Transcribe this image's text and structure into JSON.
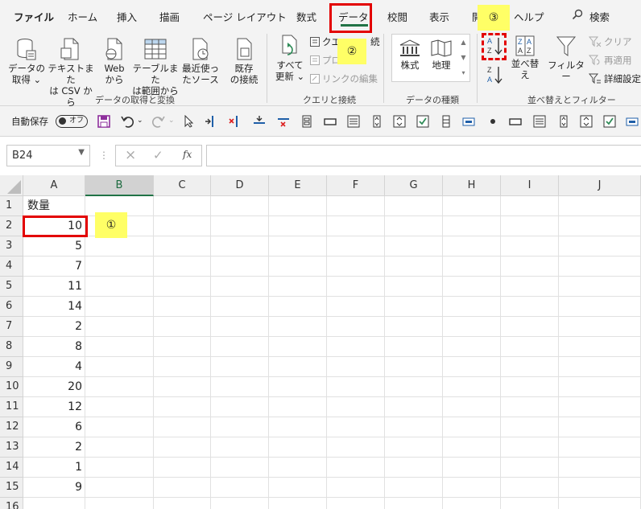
{
  "tabs": [
    "ファイル",
    "ホーム",
    "挿入",
    "描画",
    "ページ レイアウト",
    "数式",
    "データ",
    "校閲",
    "表示",
    "開",
    "ヘルプ"
  ],
  "search": {
    "icon": "search-icon",
    "label": "検索"
  },
  "ribbon": {
    "get_data": {
      "group_label": "データの取得と変換",
      "buttons": [
        {
          "line1": "データの",
          "line2": "取得 ⌄"
        },
        {
          "line1": "テキストまた",
          "line2": "は CSV から"
        },
        {
          "line1": "Web",
          "line2": "から"
        },
        {
          "line1": "テーブルまた",
          "line2": "は範囲から"
        },
        {
          "line1": "最近使っ",
          "line2": "たソース"
        },
        {
          "line1": "既存",
          "line2": "の接続"
        }
      ]
    },
    "queries": {
      "group_label": "クエリと接続",
      "refresh": {
        "line1": "すべて",
        "line2": "更新 ⌄"
      },
      "small": [
        "クエ",
        "プロ",
        "リンクの編集"
      ],
      "small_suffix": "続"
    },
    "data_types": {
      "group_label": "データの種類",
      "buttons": [
        "株式",
        "地理"
      ]
    },
    "sort_filter": {
      "group_label": "並べ替えとフィルター",
      "sort_label": "並べ替え",
      "filter_label": "フィルター",
      "clear": "クリア",
      "reapply": "再適用",
      "advanced": "詳細設定"
    }
  },
  "qat": {
    "autosave_label": "自動保存",
    "toggle_label": "オフ"
  },
  "formula_bar": {
    "name_box": "B24",
    "fx": "fx",
    "cancel": "×",
    "enter": "✓",
    "value": ""
  },
  "columns": [
    "A",
    "B",
    "C",
    "D",
    "E",
    "F",
    "G",
    "H",
    "I",
    "J"
  ],
  "rows": [
    {
      "n": "1",
      "a": "数量"
    },
    {
      "n": "2",
      "a": "10"
    },
    {
      "n": "3",
      "a": "5"
    },
    {
      "n": "4",
      "a": "7"
    },
    {
      "n": "5",
      "a": "11"
    },
    {
      "n": "6",
      "a": "14"
    },
    {
      "n": "7",
      "a": "2"
    },
    {
      "n": "8",
      "a": "8"
    },
    {
      "n": "9",
      "a": "4"
    },
    {
      "n": "10",
      "a": "20"
    },
    {
      "n": "11",
      "a": "12"
    },
    {
      "n": "12",
      "a": "6"
    },
    {
      "n": "13",
      "a": "2"
    },
    {
      "n": "14",
      "a": "1"
    },
    {
      "n": "15",
      "a": "9"
    },
    {
      "n": "16",
      "a": ""
    }
  ],
  "annotations": {
    "step1": "①",
    "step2": "②",
    "step3": "③"
  },
  "colors": {
    "accent": "#217346",
    "highlight_red": "#e30000",
    "note_yellow": "#ffff66"
  }
}
